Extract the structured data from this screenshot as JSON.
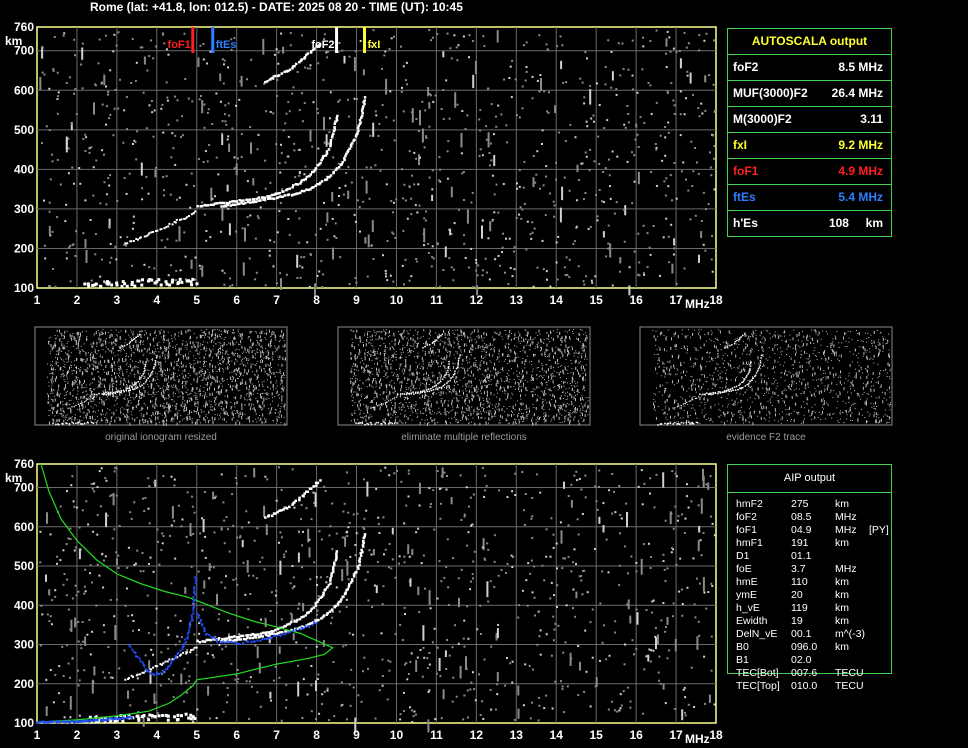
{
  "header": {
    "title": "Rome (lat: +41.8, lon: 012.5) - DATE: 2025 08 20 - TIME (UT): 10:45"
  },
  "chart_data": [
    {
      "type": "scatter",
      "name": "top-ionogram",
      "xlabel": "MHz",
      "ylabel": "km",
      "xlim": [
        1,
        18
      ],
      "ylim": [
        100,
        760
      ],
      "x_ticks": [
        1,
        2,
        3,
        4,
        5,
        6,
        7,
        8,
        9,
        10,
        11,
        12,
        13,
        14,
        15,
        16,
        17,
        18
      ],
      "y_ticks": [
        100,
        200,
        300,
        400,
        500,
        600,
        700,
        760
      ],
      "grid": true,
      "markers": [
        {
          "label": "foF1",
          "freq": 4.9,
          "color": "#ff2020"
        },
        {
          "label": "ftEs",
          "freq": 5.4,
          "color": "#2f7fff"
        },
        {
          "label": "foF2",
          "freq": 8.5,
          "color": "#ffffff"
        },
        {
          "label": "fxI",
          "freq": 9.2,
          "color": "#ffff33"
        }
      ],
      "traces": {
        "es_layer": [
          [
            2.2,
            112
          ],
          [
            2.6,
            113
          ],
          [
            3.0,
            115
          ],
          [
            3.4,
            116
          ],
          [
            3.8,
            118
          ],
          [
            4.2,
            118
          ],
          [
            4.6,
            119
          ],
          [
            5.0,
            118
          ]
        ],
        "o_f1": [
          [
            3.2,
            215
          ],
          [
            3.6,
            230
          ],
          [
            4.0,
            248
          ],
          [
            4.4,
            268
          ],
          [
            4.8,
            285
          ],
          [
            5.0,
            300
          ]
        ],
        "o_f2": [
          [
            5.0,
            310
          ],
          [
            5.6,
            318
          ],
          [
            6.2,
            325
          ],
          [
            6.8,
            335
          ],
          [
            7.2,
            350
          ],
          [
            7.6,
            372
          ],
          [
            7.9,
            398
          ],
          [
            8.1,
            425
          ],
          [
            8.3,
            460
          ],
          [
            8.4,
            500
          ],
          [
            8.5,
            545
          ]
        ],
        "x_f2": [
          [
            5.6,
            310
          ],
          [
            6.2,
            318
          ],
          [
            6.8,
            328
          ],
          [
            7.4,
            340
          ],
          [
            7.9,
            358
          ],
          [
            8.3,
            385
          ],
          [
            8.6,
            418
          ],
          [
            8.8,
            455
          ],
          [
            9.0,
            495
          ],
          [
            9.1,
            540
          ],
          [
            9.2,
            590
          ]
        ],
        "multiple": [
          [
            6.7,
            625
          ],
          [
            7.0,
            640
          ],
          [
            7.3,
            655
          ],
          [
            7.6,
            680
          ],
          [
            7.9,
            705
          ],
          [
            8.1,
            725
          ]
        ]
      }
    },
    {
      "type": "scatter",
      "name": "bottom-ionogram",
      "xlabel": "MHz",
      "ylabel": "km",
      "xlim": [
        1,
        18
      ],
      "ylim": [
        100,
        760
      ],
      "x_ticks": [
        1,
        2,
        3,
        4,
        5,
        6,
        7,
        8,
        9,
        10,
        11,
        12,
        13,
        14,
        15,
        16,
        17,
        18
      ],
      "y_ticks": [
        100,
        200,
        300,
        400,
        500,
        600,
        700,
        760
      ],
      "grid": true,
      "green_profile": [
        [
          1.1,
          760
        ],
        [
          1.3,
          690
        ],
        [
          1.6,
          620
        ],
        [
          2.0,
          565
        ],
        [
          2.5,
          515
        ],
        [
          3.0,
          480
        ],
        [
          3.6,
          455
        ],
        [
          4.2,
          435
        ],
        [
          4.8,
          420
        ],
        [
          5.3,
          400
        ],
        [
          5.8,
          380
        ],
        [
          6.4,
          360
        ],
        [
          7.0,
          345
        ],
        [
          7.6,
          328
        ],
        [
          8.0,
          310
        ],
        [
          8.4,
          292
        ],
        [
          8.2,
          275
        ],
        [
          7.8,
          265
        ],
        [
          7.0,
          250
        ],
        [
          6.0,
          225
        ],
        [
          5.0,
          210
        ],
        [
          4.9,
          195
        ],
        [
          4.6,
          170
        ],
        [
          4.3,
          150
        ],
        [
          3.8,
          130
        ],
        [
          3.0,
          118
        ],
        [
          2.0,
          108
        ],
        [
          1.0,
          102
        ]
      ],
      "blue_f1": [
        [
          3.3,
          300
        ],
        [
          3.5,
          270
        ],
        [
          3.7,
          240
        ],
        [
          3.9,
          225
        ],
        [
          4.1,
          230
        ],
        [
          4.3,
          250
        ],
        [
          4.6,
          290
        ],
        [
          4.8,
          340
        ],
        [
          4.9,
          400
        ],
        [
          4.95,
          480
        ]
      ],
      "blue_f2": [
        [
          5.0,
          380
        ],
        [
          5.2,
          330
        ],
        [
          5.5,
          310
        ],
        [
          6.0,
          305
        ],
        [
          6.6,
          315
        ],
        [
          7.2,
          330
        ],
        [
          7.8,
          350
        ],
        [
          8.0,
          362
        ]
      ],
      "blue_base": [
        [
          1.0,
          104
        ],
        [
          1.5,
          105
        ],
        [
          2.0,
          107
        ],
        [
          2.5,
          110
        ],
        [
          3.0,
          114
        ],
        [
          3.4,
          118
        ]
      ]
    }
  ],
  "thumbnails": [
    {
      "caption": "original ionogram resized"
    },
    {
      "caption": "eliminate multiple reflections"
    },
    {
      "caption": "evidence F2 trace"
    }
  ],
  "autoscala": {
    "title": "AUTOSCALA output",
    "rows": [
      {
        "name": "foF2",
        "value": "8.5 MHz",
        "color": "#ffffff"
      },
      {
        "name": "MUF(3000)F2",
        "value": "26.4 MHz",
        "color": "#ffffff"
      },
      {
        "name": "M(3000)F2",
        "value": "3.11",
        "color": "#ffffff"
      },
      {
        "name": "fxI",
        "value": "9.2 MHz",
        "color": "#ffff33"
      },
      {
        "name": "foF1",
        "value": "4.9 MHz",
        "color": "#ff2020"
      },
      {
        "name": "ftEs",
        "value": "5.4 MHz",
        "color": "#2f7fff"
      },
      {
        "name": "h'Es",
        "value": "108     km",
        "color": "#ffffff"
      }
    ]
  },
  "aip": {
    "title": "AIP output",
    "rows": [
      {
        "param": "hmF2",
        "value": "275",
        "unit": "km",
        "extra": ""
      },
      {
        "param": "foF2",
        "value": "08.5",
        "unit": "MHz",
        "extra": ""
      },
      {
        "param": "foF1",
        "value": "04.9",
        "unit": "MHz",
        "extra": "[PY]"
      },
      {
        "param": "hmF1",
        "value": "191",
        "unit": "km",
        "extra": ""
      },
      {
        "param": "D1",
        "value": "01.1",
        "unit": "",
        "extra": ""
      },
      {
        "param": "foE",
        "value": "3.7",
        "unit": "MHz",
        "extra": ""
      },
      {
        "param": "hmE",
        "value": "110",
        "unit": "km",
        "extra": ""
      },
      {
        "param": "ymE",
        "value": "20",
        "unit": "km",
        "extra": ""
      },
      {
        "param": "h_vE",
        "value": "119",
        "unit": "km",
        "extra": ""
      },
      {
        "param": "Ewidth",
        "value": "19",
        "unit": "km",
        "extra": ""
      },
      {
        "param": "DelN_vE",
        "value": "00.1",
        "unit": "m^(-3)",
        "extra": ""
      },
      {
        "param": "B0",
        "value": "096.0",
        "unit": "km",
        "extra": ""
      },
      {
        "param": "B1",
        "value": "02.0",
        "unit": "",
        "extra": ""
      },
      {
        "param": "TEC[Bot]",
        "value": "007.6",
        "unit": "TECU",
        "extra": ""
      },
      {
        "param": "TEC[Top]",
        "value": "010.0",
        "unit": "TECU",
        "extra": ""
      }
    ]
  }
}
